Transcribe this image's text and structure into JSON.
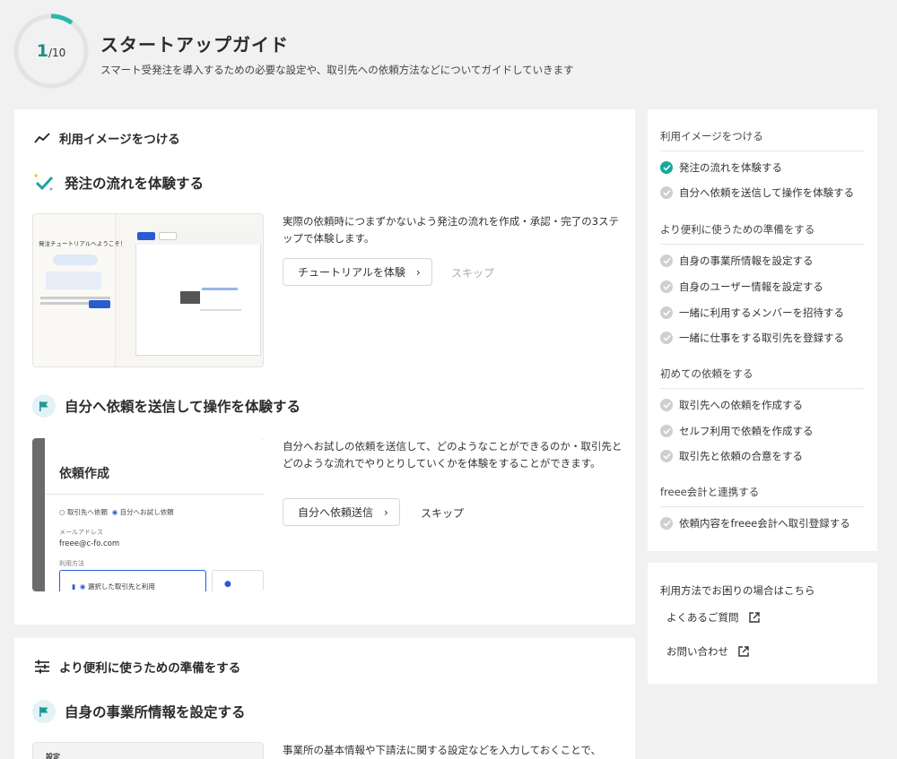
{
  "progress": {
    "current": "1",
    "total": "/10",
    "fraction": 0.1,
    "accent": "#2ab7b0"
  },
  "header": {
    "title": "スタートアップガイド",
    "subtitle": "スマート受発注を導入するための必要な設定や、取引先への依頼方法などについてガイドしていきます"
  },
  "main": {
    "section1": {
      "title": "利用イメージをつける",
      "icon": "trend-icon",
      "task1": {
        "title": "発注の流れを体験する",
        "desc": "実際の依頼時につまずかないよう発注の流れを作成・承認・完了の3ステップで体験します。",
        "button": "チュートリアルを体験",
        "skip": "スキップ",
        "thumb": {
          "heading": "発注チュートリアルへようこそ！"
        }
      },
      "task2": {
        "title": "自分へ依頼を送信して操作を体験する",
        "desc": "自分へお試しの依頼を送信して、どのようなことができるのか・取引先とどのような流れでやりとりしていくかを体験をすることができます。",
        "button": "自分へ依頼送信",
        "skip": "スキップ",
        "thumb": {
          "heading": "依頼作成",
          "radio1": "取引先へ依頼",
          "radio2": "自分へお試し依頼",
          "email_label": "メールアドレス",
          "email": "freee@c-fo.com",
          "usage_label": "利用方法",
          "usage_option": "選択した取引先と利用"
        }
      }
    },
    "section2": {
      "title": "より便利に使うための準備をする",
      "icon": "sliders-icon",
      "task1": {
        "title": "自身の事業所情報を設定する",
        "desc": "事業所の基本情報や下請法に関する設定などを入力しておくことで、",
        "thumb": {
          "heading": "設定"
        }
      }
    }
  },
  "sidebar": {
    "groups": [
      {
        "title": "利用イメージをつける",
        "items": [
          {
            "label": "発注の流れを体験する",
            "done": true
          },
          {
            "label": "自分へ依頼を送信して操作を体験する",
            "done": false
          }
        ]
      },
      {
        "title": "より便利に使うための準備をする",
        "items": [
          {
            "label": "自身の事業所情報を設定する",
            "done": false
          },
          {
            "label": "自身のユーザー情報を設定する",
            "done": false
          },
          {
            "label": "一緒に利用するメンバーを招待する",
            "done": false
          },
          {
            "label": "一緒に仕事をする取引先を登録する",
            "done": false
          }
        ]
      },
      {
        "title": "初めての依頼をする",
        "items": [
          {
            "label": "取引先への依頼を作成する",
            "done": false
          },
          {
            "label": "セルフ利用で依頼を作成する",
            "done": false
          },
          {
            "label": "取引先と依頼の合意をする",
            "done": false
          }
        ]
      },
      {
        "title": "freee会計と連携する",
        "items": [
          {
            "label": "依頼内容をfreee会計へ取引登録する",
            "done": false
          }
        ]
      }
    ],
    "help": {
      "title": "利用方法でお困りの場合はこちら",
      "faq": "よくあるご質問",
      "contact": "お問い合わせ"
    }
  }
}
